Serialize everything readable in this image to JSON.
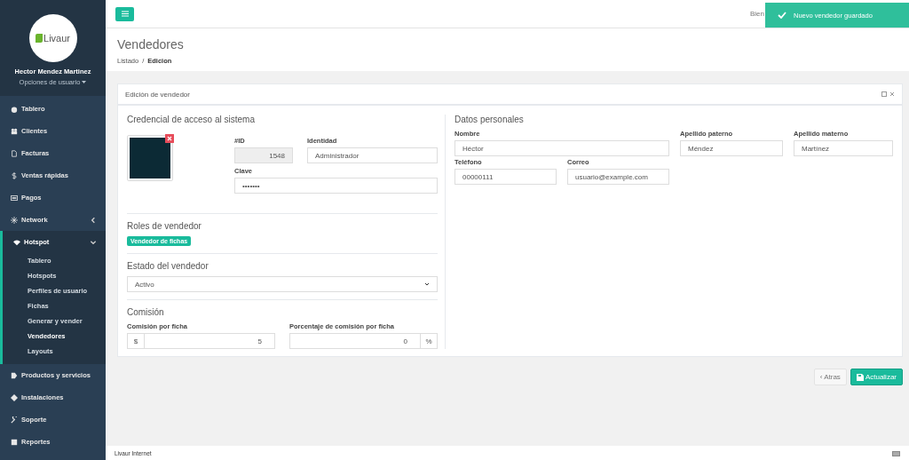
{
  "sidebar": {
    "logo_text": "Livaur",
    "user_name": "Hector Mendez Martinez",
    "user_menu": "Opciones de usuario",
    "items": [
      {
        "label": "Tablero",
        "kind": "link",
        "selected": false
      },
      {
        "label": "Clientes",
        "kind": "link",
        "selected": false
      },
      {
        "label": "Facturas",
        "kind": "link",
        "selected": false
      },
      {
        "label": "Ventas rápidas",
        "kind": "link",
        "selected": false
      },
      {
        "label": "Pagos",
        "kind": "link",
        "selected": false
      },
      {
        "label": "Network",
        "kind": "group",
        "selected": false,
        "expanded": false
      },
      {
        "label": "Hotspot",
        "kind": "group",
        "selected": true,
        "expanded": true,
        "children": [
          {
            "label": "Tablero",
            "selected": false
          },
          {
            "label": "Hotspots",
            "selected": false
          },
          {
            "label": "Perfiles de usuario",
            "selected": false
          },
          {
            "label": "Fichas",
            "selected": false
          },
          {
            "label": "Generar y vender",
            "selected": false
          },
          {
            "label": "Vendedores",
            "selected": true
          },
          {
            "label": "Layouts",
            "selected": false
          }
        ]
      },
      {
        "label": "Productos y servicios",
        "kind": "link",
        "selected": false
      },
      {
        "label": "Instalaciones",
        "kind": "link",
        "selected": false
      },
      {
        "label": "Soporte",
        "kind": "link",
        "selected": false
      },
      {
        "label": "Reportes",
        "kind": "link",
        "selected": false
      }
    ]
  },
  "topbar": {
    "greeting": "Bien"
  },
  "toast": {
    "message": "Nuevo vendedor guardado"
  },
  "page": {
    "title": "Vendedores",
    "breadcrumb_separator": "/",
    "breadcrumb": [
      {
        "label": "Listado",
        "selected": false
      },
      {
        "label": "Edicion",
        "selected": true
      }
    ]
  },
  "panel": {
    "title": "Edición de vendedor",
    "credentials": {
      "heading": "Credencial de acceso al sistema",
      "id_label": "#ID",
      "id_value": "1548",
      "identity_label": "Identidad",
      "identity_value": "Administrador",
      "password_label": "Clave",
      "password_value": "•••••••"
    },
    "roles": {
      "heading": "Roles de vendedor",
      "tags": [
        "Vendedor de fichas"
      ]
    },
    "status": {
      "heading": "Estado del vendedor",
      "value": "Activo"
    },
    "commission": {
      "heading": "Comisión",
      "per_ticket_label": "Comisión por ficha",
      "currency": "$",
      "per_ticket_value": "5",
      "percent_label": "Porcentaje de comisión por ficha",
      "percent_value": "0",
      "percent_unit": "%"
    },
    "personal": {
      "heading": "Datos personales",
      "fields": [
        {
          "label": "Nombre",
          "value": "Héctor"
        },
        {
          "label": "Apellido paterno",
          "value": "Méndez"
        },
        {
          "label": "Apellido materno",
          "value": "Martínez"
        },
        {
          "label": "Teléfono",
          "value": "00000111"
        },
        {
          "label": "Correo",
          "value": "usuario@example.com"
        }
      ]
    }
  },
  "actions": {
    "back": "‹ Atras",
    "save": "Actualizar"
  },
  "footer": {
    "text": "Livaur Internet"
  }
}
